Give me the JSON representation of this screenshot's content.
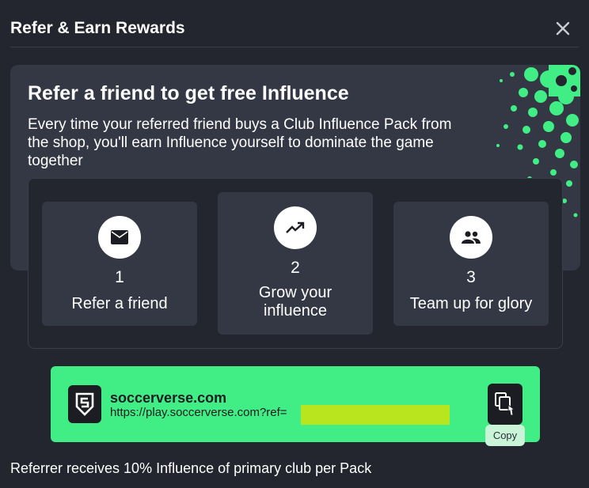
{
  "dialog": {
    "title": "Refer & Earn Rewards",
    "close_icon": "close-icon"
  },
  "hero": {
    "title": "Refer a friend to get free Influence",
    "description": "Every time your referred friend buys a Club Influence Pack from the shop, you'll earn Influence yourself to dominate the game together"
  },
  "steps": [
    {
      "number": "1",
      "label": "Refer a friend",
      "icon": "mail-icon"
    },
    {
      "number": "2",
      "label": "Grow your influence",
      "icon": "trending-up-icon"
    },
    {
      "number": "3",
      "label": "Team up for glory",
      "icon": "group-icon"
    }
  ],
  "referral": {
    "site": "soccerverse.com",
    "url": "https://play.soccerverse.com?ref=",
    "copy_tooltip": "Copy",
    "icon": "copy-icon"
  },
  "footer": {
    "note": "Referrer receives 10% Influence of primary club per Pack"
  },
  "colors": {
    "background": "#23262f",
    "panel": "#343845",
    "accent": "#40ee85",
    "dark": "#1b1d22"
  }
}
